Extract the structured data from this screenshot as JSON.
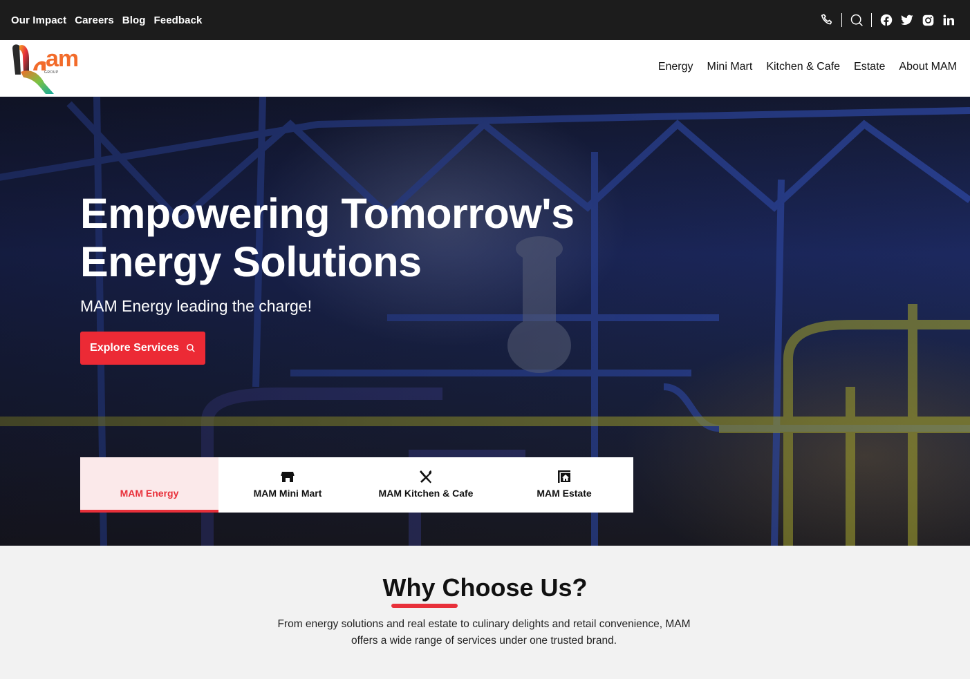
{
  "topbar": {
    "links": [
      "Our Impact",
      "Careers",
      "Blog",
      "Feedback"
    ],
    "icons": [
      "phone-icon",
      "search-icon",
      "facebook-icon",
      "twitter-icon",
      "instagram-icon",
      "linkedin-icon"
    ]
  },
  "header": {
    "logo_text": "am",
    "logo_subtext": "GROUP",
    "nav": [
      "Energy",
      "Mini Mart",
      "Kitchen & Cafe",
      "Estate",
      "About MAM"
    ]
  },
  "hero": {
    "title": "Empowering Tomorrow's Energy Solutions",
    "subtitle": "MAM Energy leading the charge!",
    "cta_label": "Explore Services"
  },
  "tabs": [
    {
      "label": "MAM Energy",
      "icon": "bolt-icon",
      "active": true
    },
    {
      "label": "MAM Mini Mart",
      "icon": "store-icon",
      "active": false
    },
    {
      "label": "MAM Kitchen & Cafe",
      "icon": "utensils-icon",
      "active": false
    },
    {
      "label": "MAM Estate",
      "icon": "estate-icon",
      "active": false
    }
  ],
  "why": {
    "title": "Why Choose Us?",
    "text": "From energy solutions and real estate to culinary delights and retail convenience, MAM offers a wide range of services under one trusted brand."
  },
  "colors": {
    "accent": "#ec2a35",
    "topbar_bg": "#1c1c1c",
    "active_tab_bg": "#fbe9ea",
    "section_bg": "#f2f2f2"
  }
}
